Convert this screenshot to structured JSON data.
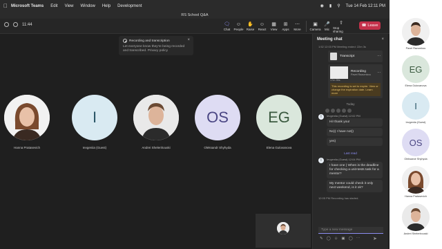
{
  "menubar": {
    "app": "Microsoft Teams",
    "items": [
      "Edit",
      "View",
      "Window",
      "Help",
      "Development"
    ],
    "datetime": "Tue 14 Feb  12:11 PM"
  },
  "window": {
    "title": "RS School Q&A",
    "timer": "11:44"
  },
  "toolbar": {
    "buttons": [
      {
        "icon": "chat-icon",
        "label": "Chat"
      },
      {
        "icon": "people-icon",
        "label": "People"
      },
      {
        "icon": "raise-hand-icon",
        "label": "Raise"
      },
      {
        "icon": "react-icon",
        "label": "React"
      },
      {
        "icon": "view-icon",
        "label": "View"
      },
      {
        "icon": "apps-icon",
        "label": "Apps"
      },
      {
        "icon": "more-icon",
        "label": "More"
      },
      {
        "icon": "camera-icon",
        "label": "Camera"
      },
      {
        "icon": "mic-icon",
        "label": "Mic"
      },
      {
        "icon": "share-icon",
        "label": "Stop sharing"
      }
    ],
    "leave_label": "Leave"
  },
  "toast": {
    "title": "Recording and transcription",
    "body": "Let everyone know they're being recorded and transcribed. Privacy policy"
  },
  "participants": [
    {
      "name": "Hanna Pratasevich",
      "initials": "",
      "bg": "#ffffff",
      "fg": "#000000",
      "photo": true
    },
    {
      "name": "Ievgeniia (Guest)",
      "initials": "I",
      "bg": "#d9eaf2",
      "fg": "#2a5566",
      "photo": false
    },
    {
      "name": "Andrei Shelenhouski",
      "initials": "",
      "bg": "#ffffff",
      "fg": "#000000",
      "photo": true
    },
    {
      "name": "Oleksandr Shyhyda",
      "initials": "OS",
      "bg": "#dedcf3",
      "fg": "#4b4784",
      "photo": false
    },
    {
      "name": "Elena Gulovanova",
      "initials": "EG",
      "bg": "#dae7dc",
      "fg": "#3b5a40",
      "photo": false
    }
  ],
  "chat": {
    "title": "Meeting chat",
    "system_1": "1:52 12:03 PM  Meeting ended: 22m 3s",
    "transcript_label": "Transcript",
    "recording_label": "Recording",
    "recording_by": "Pavel Razumkou",
    "recording_duration": "17m 55s",
    "recording_warning": "This recording is set to expire. View or change the expiration date. Learn more",
    "today_label": "Today",
    "msg1_author": "Ievgeniia (Guest)",
    "msg1_time": "12:02 PM",
    "msg1_lines": [
      "Hi! thank you!",
      "No)) I have not))",
      "yes)"
    ],
    "lastread_label": "Last read",
    "msg2_author": "Ievgeniia (Guest)",
    "msg2_time": "12:04 PM",
    "msg2_lines": [
      "I have one ) When is the deadline for checking a unit-tests task for a mentor?",
      "My mentor could check it only next weekend, is it ok?"
    ],
    "system_2": "12:05 PM   Recording has started.",
    "compose_placeholder": "Type a new message"
  },
  "rail": [
    {
      "name": "Pavel Razumkou",
      "initials": "",
      "bg": "#f0f0f0",
      "fg": "#000",
      "photo": true
    },
    {
      "name": "Elena Gulovanova",
      "initials": "EG",
      "bg": "#dae7dc",
      "fg": "#3b5a40",
      "photo": false
    },
    {
      "name": "Ievgeniia (Guest)",
      "initials": "I",
      "bg": "#d9eaf2",
      "fg": "#2a5566",
      "photo": false
    },
    {
      "name": "Oleksandr Shyhyda",
      "initials": "OS",
      "bg": "#dedcf3",
      "fg": "#4b4784",
      "photo": false
    },
    {
      "name": "Hanna Pratasevich",
      "initials": "",
      "bg": "#f0f0f0",
      "fg": "#000",
      "photo": true
    },
    {
      "name": "Andrei Shelenhouski",
      "initials": "",
      "bg": "#f0f0f0",
      "fg": "#000",
      "photo": true
    }
  ]
}
